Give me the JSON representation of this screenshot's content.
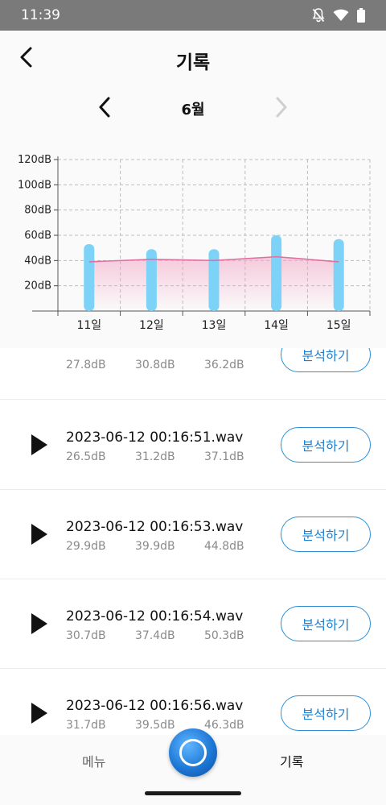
{
  "status_bar": {
    "time": "11:39",
    "icons": [
      "notifications-off-icon",
      "wifi-icon",
      "battery-icon"
    ]
  },
  "header": {
    "title": "기록",
    "back_icon": "back-arrow-icon"
  },
  "month_nav": {
    "label": "6월",
    "prev_icon": "chevron-left-icon",
    "next_icon": "chevron-right-icon"
  },
  "chart_data": {
    "type": "bar",
    "categories": [
      "11일",
      "12일",
      "13일",
      "14일",
      "15일"
    ],
    "series": [
      {
        "values": [
          53,
          49,
          49,
          60,
          57
        ],
        "color": "#7dd3f7"
      },
      {
        "type": "line",
        "values": [
          39,
          41,
          40,
          43,
          39
        ],
        "color": "#e070a0"
      }
    ],
    "ylim": [
      0,
      120
    ],
    "yticks": [
      "20dB",
      "40dB",
      "60dB",
      "80dB",
      "100dB",
      "120dB"
    ],
    "grid": true
  },
  "recordings": [
    {
      "file": "",
      "db": [
        "27.8dB",
        "30.8dB",
        "36.2dB"
      ],
      "button": "분석하기"
    },
    {
      "file": "2023-06-12 00:16:51.wav",
      "db": [
        "26.5dB",
        "31.2dB",
        "37.1dB"
      ],
      "button": "분석하기"
    },
    {
      "file": "2023-06-12 00:16:53.wav",
      "db": [
        "29.9dB",
        "39.9dB",
        "44.8dB"
      ],
      "button": "분석하기"
    },
    {
      "file": "2023-06-12 00:16:54.wav",
      "db": [
        "30.7dB",
        "37.4dB",
        "50.3dB"
      ],
      "button": "분석하기"
    },
    {
      "file": "2023-06-12 00:16:56.wav",
      "db": [
        "31.7dB",
        "39.5dB",
        "46.3dB"
      ],
      "button": "분석하기"
    }
  ],
  "bottom_nav": {
    "menu_label": "메뉴",
    "record_label": "기록",
    "center_icon": "record-icon"
  },
  "colors": {
    "accent": "#1f7fcf",
    "bar": "#7dd3f7",
    "line": "#e070a0",
    "status_bar": "#7a7a7a"
  }
}
